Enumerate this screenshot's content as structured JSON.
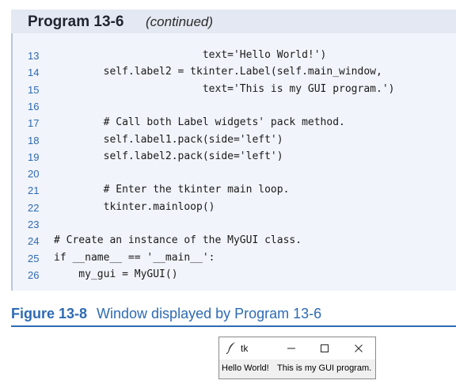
{
  "listing": {
    "title": "Program 13-6",
    "continued": "(continued)",
    "lines": [
      {
        "n": "13",
        "code": "                        text='Hello World!')"
      },
      {
        "n": "14",
        "code": "        self.label2 = tkinter.Label(self.main_window,"
      },
      {
        "n": "15",
        "code": "                        text='This is my GUI program.')"
      },
      {
        "n": "16",
        "code": ""
      },
      {
        "n": "17",
        "code": "        # Call both Label widgets' pack method."
      },
      {
        "n": "18",
        "code": "        self.label1.pack(side='left')"
      },
      {
        "n": "19",
        "code": "        self.label2.pack(side='left')"
      },
      {
        "n": "20",
        "code": ""
      },
      {
        "n": "21",
        "code": "        # Enter the tkinter main loop."
      },
      {
        "n": "22",
        "code": "        tkinter.mainloop()"
      },
      {
        "n": "23",
        "code": ""
      },
      {
        "n": "24",
        "code": "# Create an instance of the MyGUI class."
      },
      {
        "n": "25",
        "code": "if __name__ == '__main__':"
      },
      {
        "n": "26",
        "code": "    my_gui = MyGUI()"
      }
    ]
  },
  "figure": {
    "label": "Figure 13-8",
    "caption": "Window displayed by Program 13-6"
  },
  "window": {
    "title": "tk",
    "icon": "feather-icon",
    "buttons": [
      "minimize-icon",
      "maximize-icon",
      "close-icon"
    ],
    "label1": "Hello World!",
    "label2": "This is my GUI program."
  },
  "colors": {
    "accent": "#2d6bb3",
    "header_bg": "#e3e8f2",
    "code_bg": "#f1f4fa"
  }
}
